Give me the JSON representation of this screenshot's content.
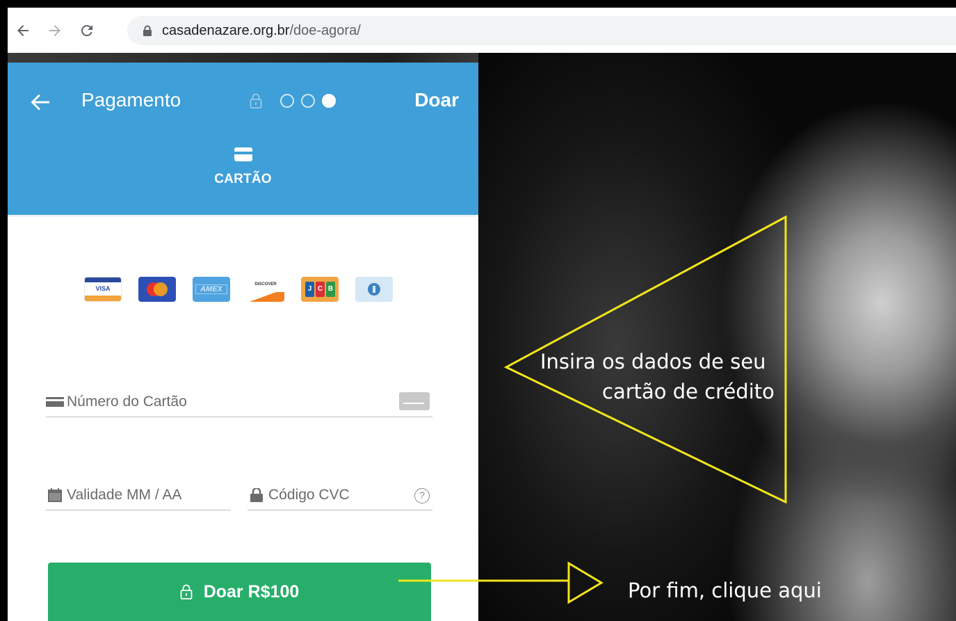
{
  "browser": {
    "url_host": "casadenazare.org.br",
    "url_path": "/doe-agora/"
  },
  "panel": {
    "title": "Pagamento",
    "donate_link": "Doar",
    "tab_label": "CARTÃO",
    "card_brands": [
      "visa-icon",
      "mastercard-icon",
      "amex-icon",
      "discover-icon",
      "jcb-icon",
      "diners-icon"
    ],
    "brand_texts": {
      "visa": "VISA",
      "amex": "AMEX",
      "discover": "DISCOVER",
      "jcb": [
        "J",
        "C",
        "B"
      ]
    },
    "fields": {
      "card_number": "Número do Cartão",
      "expiry": "Validade MM / AA",
      "cvc": "Código CVC",
      "cvc_help": "?"
    },
    "donate_button": "Doar R$100",
    "steps": {
      "total": 3,
      "active": 3
    }
  },
  "annotations": {
    "line1": "Insira os dados de seu",
    "line2": "cartão de crédito",
    "line3": "Por fim, clique aqui"
  },
  "colors": {
    "header": "#3f9fd8",
    "button": "#27ae6a",
    "annotation": "#f2e51b"
  }
}
